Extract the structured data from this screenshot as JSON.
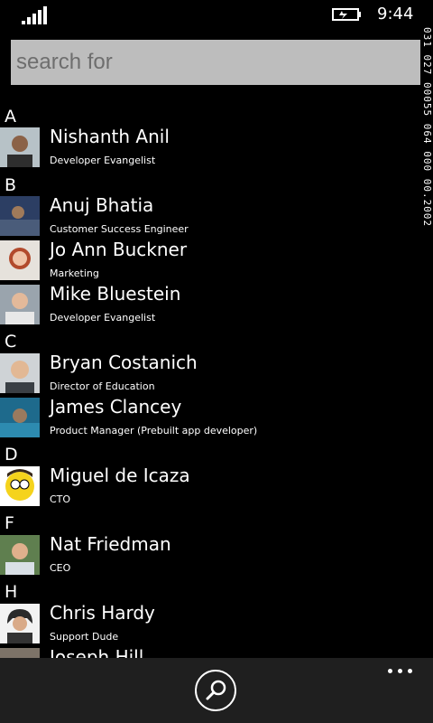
{
  "status_bar": {
    "time": "9:44",
    "signal_icon": "signal-bars-icon",
    "battery_icon": "battery-charging-icon"
  },
  "search": {
    "placeholder": "search for"
  },
  "side_debug": "031 027 00055 064 000 00.2002",
  "groups": [
    {
      "letter": "A",
      "contacts": [
        {
          "name": "Nishanth Anil",
          "title": "Developer Evangelist"
        }
      ]
    },
    {
      "letter": "B",
      "contacts": [
        {
          "name": "Anuj Bhatia",
          "title": "Customer Success Engineer"
        },
        {
          "name": "Jo Ann Buckner",
          "title": "Marketing"
        },
        {
          "name": "Mike Bluestein",
          "title": "Developer Evangelist"
        }
      ]
    },
    {
      "letter": "C",
      "contacts": [
        {
          "name": "Bryan Costanich",
          "title": "Director of Education"
        },
        {
          "name": "James Clancey",
          "title": "Product Manager (Prebuilt app developer)"
        }
      ]
    },
    {
      "letter": "D",
      "contacts": [
        {
          "name": "Miguel de Icaza",
          "title": "CTO"
        }
      ]
    },
    {
      "letter": "F",
      "contacts": [
        {
          "name": "Nat Friedman",
          "title": "CEO"
        }
      ]
    },
    {
      "letter": "H",
      "contacts": [
        {
          "name": "Chris Hardy",
          "title": "Support Dude"
        },
        {
          "name": "Joseph Hill",
          "title": ""
        }
      ]
    }
  ],
  "app_bar": {
    "search_icon": "search-icon",
    "more_icon": "more-ellipsis-icon"
  }
}
